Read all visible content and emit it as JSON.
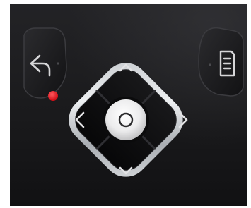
{
  "photo": {
    "subject": "remote-control-navigation-pad",
    "colors": {
      "remote_body": "#1d1d1f",
      "remote_body_light": "#2a2a2d",
      "ring": "#b9bcc0",
      "ring_highlight": "#e6e8ea",
      "dpad_key": "#0d0d0f",
      "ok_button": "#e9e9ea",
      "glyph": "#d8d8da",
      "indicator_led": "#e11b23",
      "background": "#ffffff"
    }
  },
  "buttons": {
    "back": {
      "icon": "back-arrow-icon"
    },
    "menu": {
      "icon": "document-list-icon"
    },
    "up": {
      "icon": "chevron-up-icon"
    },
    "down": {
      "icon": "chevron-down-icon"
    },
    "left": {
      "icon": "chevron-left-icon"
    },
    "right": {
      "icon": "chevron-right-icon"
    },
    "ok": {
      "icon": "circle-icon"
    }
  },
  "indicator": {
    "icon": "red-dot-icon",
    "color": "#e11b23"
  }
}
